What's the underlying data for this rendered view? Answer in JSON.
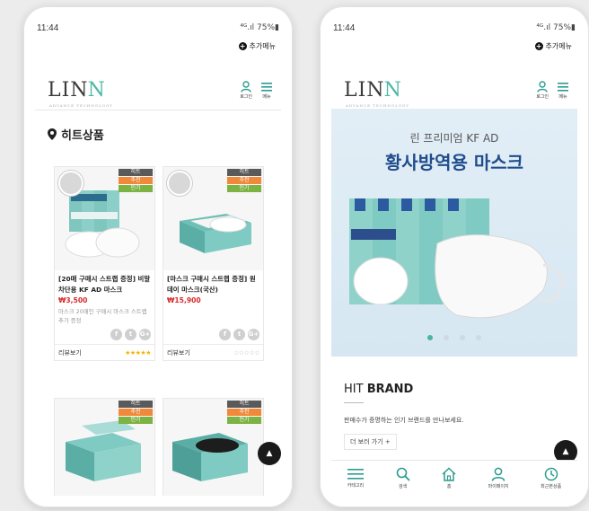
{
  "status": {
    "time": "11:44",
    "indicators": "⁴ᴳ.ıl 75%▮"
  },
  "menu_add_label": "추가메뉴",
  "brand": {
    "logo": "LIN",
    "tagline": "ADVANCE TECHNOLOGY"
  },
  "header": {
    "login_label": "로그인",
    "menu_label": "메뉴"
  },
  "left": {
    "section_title": "히트상품",
    "badges": {
      "hit": "히트",
      "rec": "추천",
      "pop": "인기"
    },
    "products": [
      {
        "name": "[20매 구매시 스트랩 증정] 비말차단용 KF AD 마스크",
        "price": "₩3,500",
        "desc": "마스크 20매인 구매시 마스크 스트랩 추가 증정",
        "share": [
          "f",
          "t",
          "G+"
        ],
        "review": "리뷰보기",
        "stars": "★★★★★"
      },
      {
        "name": "[마스크 구매시 스트랩 증정] 원데이 마스크(국산)",
        "price": "₩15,900",
        "desc": "",
        "share": [
          "f",
          "t",
          "G+"
        ],
        "review": "리뷰보기",
        "stars": "☆☆☆☆☆"
      }
    ]
  },
  "right": {
    "hero_subtitle": "린 프리미엄 KF AD",
    "hero_title": "황사방역용 마스크",
    "hit_brand": {
      "prefix": "HIT ",
      "bold": "BRAND",
      "description": "판매수가 증명하는 인기 브랜드를 만나보세요.",
      "more": "더 보러 가기 +"
    },
    "nav": [
      {
        "label": "카테고리",
        "icon": "hamburger-icon"
      },
      {
        "label": "검색",
        "icon": "search-icon"
      },
      {
        "label": "홈",
        "icon": "home-icon"
      },
      {
        "label": "마이페이지",
        "icon": "user-icon"
      },
      {
        "label": "최근본상품",
        "icon": "clock-icon"
      }
    ]
  },
  "colors": {
    "accent": "#2b9c8f",
    "hero_title": "#1f4c8c",
    "price": "#d62b2b"
  }
}
